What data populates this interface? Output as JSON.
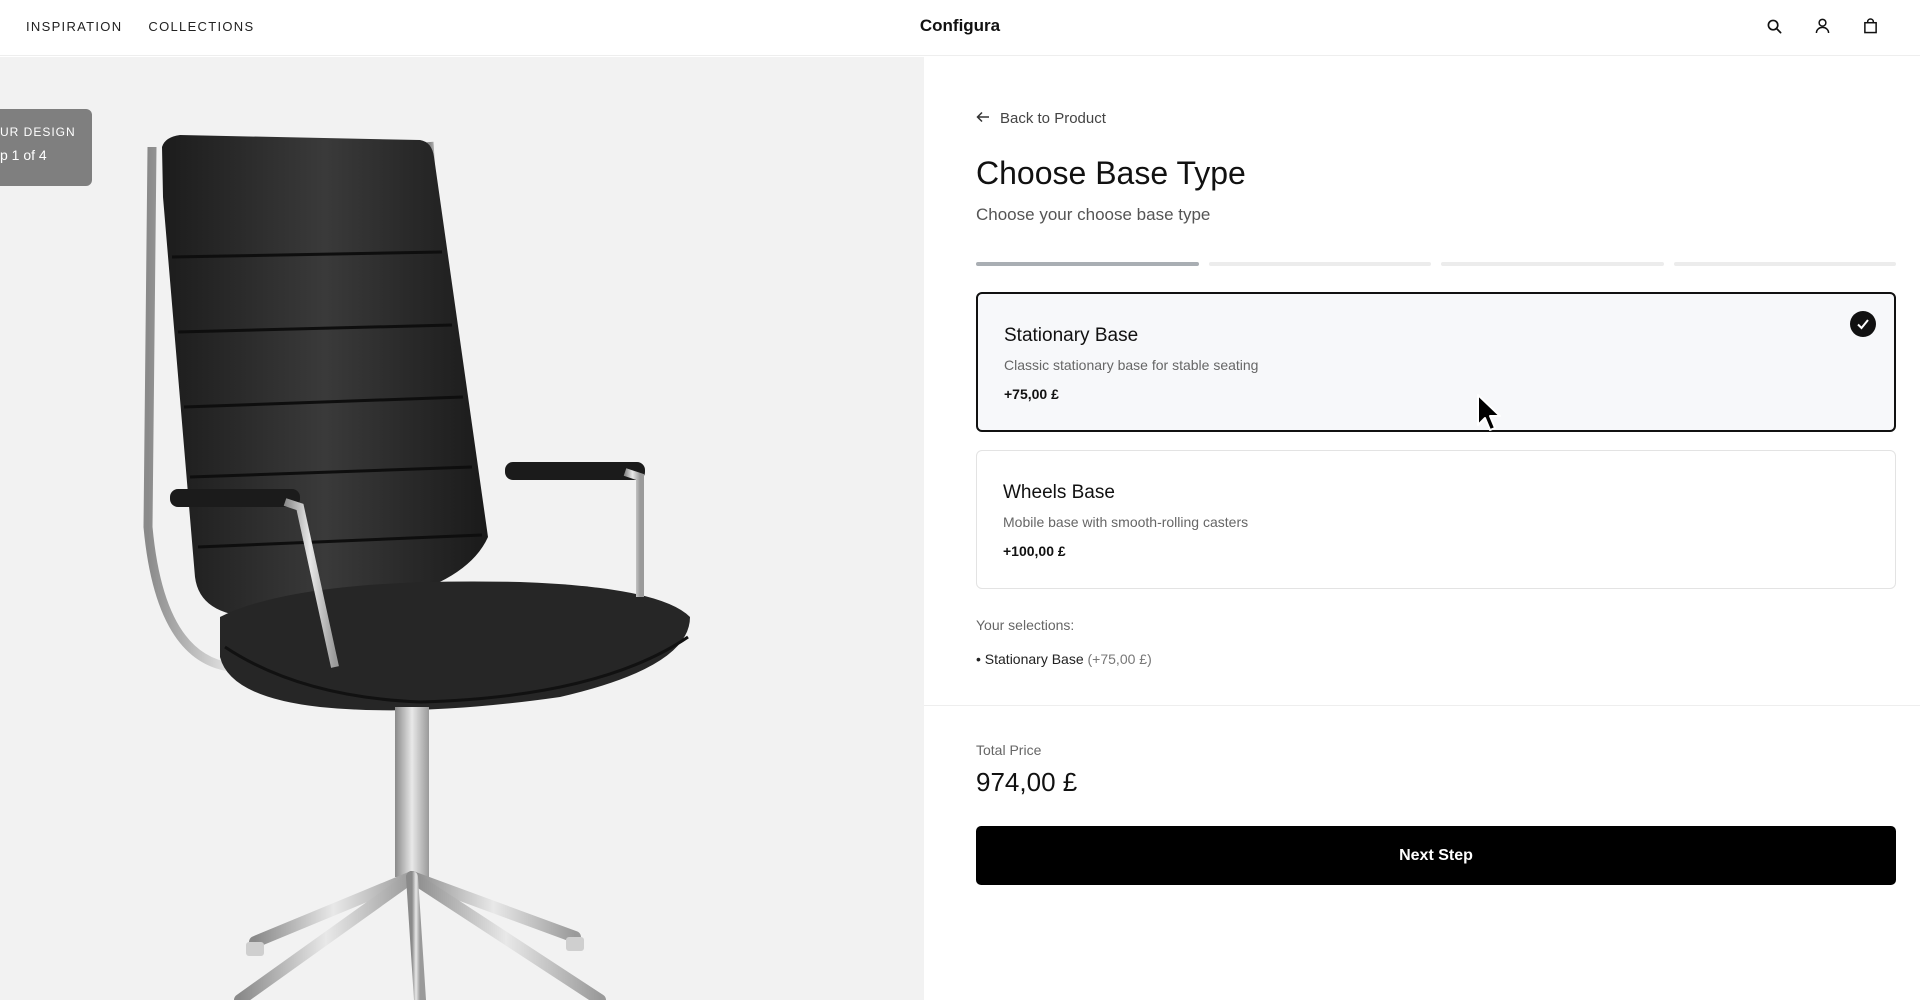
{
  "header": {
    "nav": [
      {
        "label": "INSPIRATION"
      },
      {
        "label": "COLLECTIONS"
      }
    ],
    "brand": "Configura",
    "icons": [
      "search-icon",
      "user-icon",
      "bag-icon"
    ]
  },
  "preview": {
    "badge_line1": "UR DESIGN",
    "badge_line2": "p 1 of 4"
  },
  "config": {
    "back_label": "Back to Product",
    "title": "Choose Base Type",
    "subtitle": "Choose your choose base type",
    "progress": {
      "current_step": 1,
      "total_steps": 4
    },
    "options": [
      {
        "name": "Stationary Base",
        "description": "Classic stationary base for stable seating",
        "price": "+75,00 £",
        "selected": true
      },
      {
        "name": "Wheels Base",
        "description": "Mobile base with smooth-rolling casters",
        "price": "+100,00 £",
        "selected": false
      }
    ],
    "selections_label": "Your selections:",
    "selection_item_name": "• Stationary Base",
    "selection_item_price": "(+75,00 £)",
    "total_label": "Total Price",
    "total_value": "974,00 £",
    "next_label": "Next Step"
  },
  "colors": {
    "accent": "#000000",
    "progress_active": "#a9aeb3",
    "progress_inactive": "#ececec",
    "badge": "#7f7f7f"
  }
}
